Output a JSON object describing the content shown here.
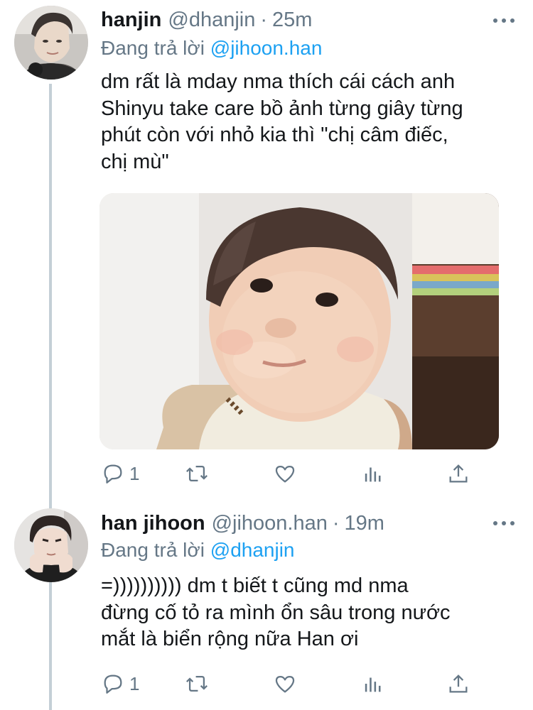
{
  "tweets": [
    {
      "name": "hanjin",
      "handle": "@dhanjin",
      "separator": "·",
      "time": "25m",
      "reply_prefix": "Đang trả lời",
      "reply_to": "@jihoon.han",
      "text": "dm rất là mday nma thích cái cách anh\nShinyu take care bồ ảnh từng giây từng\nphút còn với nhỏ kia thì \"chị câm điếc,\nchị mù\"",
      "media": "photo",
      "actions": {
        "reply_count": "1",
        "retweet_count": "",
        "like_count": ""
      }
    },
    {
      "name": "han jihoon",
      "handle": "@jihoon.han",
      "separator": "·",
      "time": "19m",
      "reply_prefix": "Đang trả lời",
      "reply_to": "@dhanjin",
      "text": "=)))))))))) dm t biết t cũng md nma\nđừng cố tỏ ra mình ổn sâu trong nước\nmắt là biển rộng nữa Han ơi",
      "actions": {
        "reply_count": "1",
        "retweet_count": "",
        "like_count": ""
      }
    }
  ],
  "icons": {
    "reply": "reply-icon",
    "retweet": "retweet-icon",
    "like": "heart-icon",
    "stats": "analytics-icon",
    "share": "share-icon",
    "more": "more-icon"
  },
  "colors": {
    "text": "#14171a",
    "secondary": "#657786",
    "link": "#1da1f2",
    "thread_line": "#c4cfd6"
  }
}
